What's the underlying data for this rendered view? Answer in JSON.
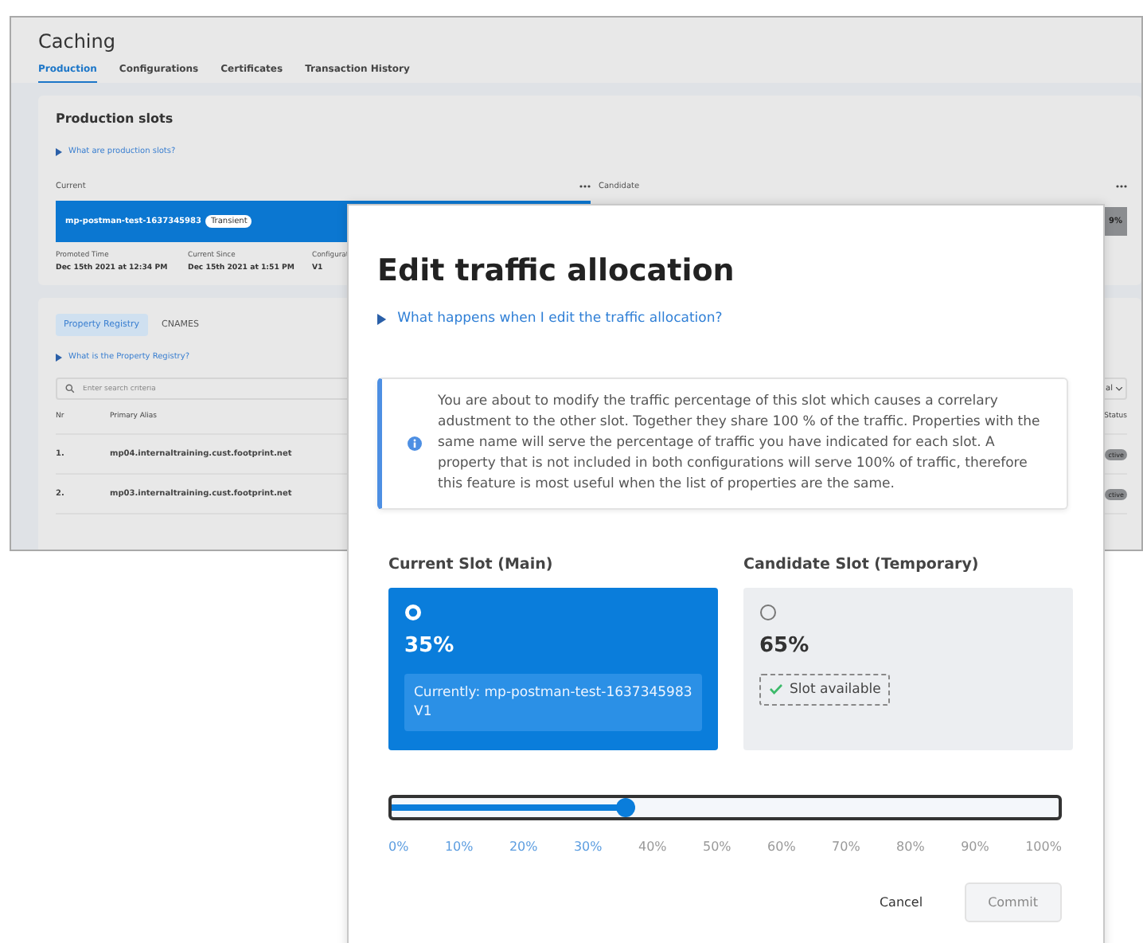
{
  "background_page": {
    "title": "Caching",
    "tabs": [
      {
        "label": "Production",
        "selected": true
      },
      {
        "label": "Configurations",
        "selected": false
      },
      {
        "label": "Certificates",
        "selected": false
      },
      {
        "label": "Transaction History",
        "selected": false
      }
    ],
    "slots_card": {
      "title": "Production slots",
      "help_link": "What are production slots?",
      "current_label": "Current",
      "candidate_label": "Candidate",
      "current_slot": {
        "name": "mp-postman-test-1637345983",
        "badge": "Transient"
      },
      "candidate_share": "9%",
      "details": [
        {
          "label": "Promoted Time",
          "value": "Dec 15th 2021 at 12:34 PM"
        },
        {
          "label": "Current Since",
          "value": "Dec 15th 2021 at 1:51 PM"
        },
        {
          "label": "Configurat",
          "value": "V1"
        }
      ]
    },
    "registry_card": {
      "tabs": [
        {
          "label": "Property Registry",
          "selected": true
        },
        {
          "label": "CNAMES",
          "selected": false
        }
      ],
      "help_link": "What is the Property Registry?",
      "search": {
        "placeholder": "Enter search criteria"
      },
      "filter_value": "al",
      "columns": [
        "Nr",
        "Primary Alias",
        "Status"
      ],
      "rows": [
        {
          "nr": "1.",
          "alias": "mp04.internaltraining.cust.footprint.net",
          "status": "ctive"
        },
        {
          "nr": "2.",
          "alias": "mp03.internaltraining.cust.footprint.net",
          "status": "ctive"
        }
      ]
    }
  },
  "modal": {
    "title": "Edit traffic allocation",
    "help_link": "What happens when I edit the traffic allocation?",
    "info": "You are about to modify the traffic percentage of this slot which causes a correlary adustment to the other slot. Together they share 100 % of the traffic. Properties with the same name will serve the percentage of traffic you have indicated for each slot. A property that is not included in both configurations will serve 100% of traffic, therefore this feature is most useful when the list of properties are the same.",
    "slots": [
      {
        "heading": "Current Slot (Main)",
        "selected": true,
        "share": "35%",
        "kind": "current",
        "note": "Currently: mp-postman-test-1637345983 V1"
      },
      {
        "heading": "Candidate Slot (Temporary)",
        "selected": false,
        "share": "65%",
        "kind": "available",
        "note": "Slot available"
      }
    ],
    "slider": {
      "level": 0.35,
      "ticks": [
        "0%",
        "10%",
        "20%",
        "30%",
        "40%",
        "50%",
        "60%",
        "70%",
        "80%",
        "90%",
        "100%"
      ]
    },
    "buttons": [
      {
        "label": "Cancel",
        "kind": "text",
        "disabled": false
      },
      {
        "label": "Commit",
        "kind": "primary",
        "disabled": true
      }
    ]
  }
}
